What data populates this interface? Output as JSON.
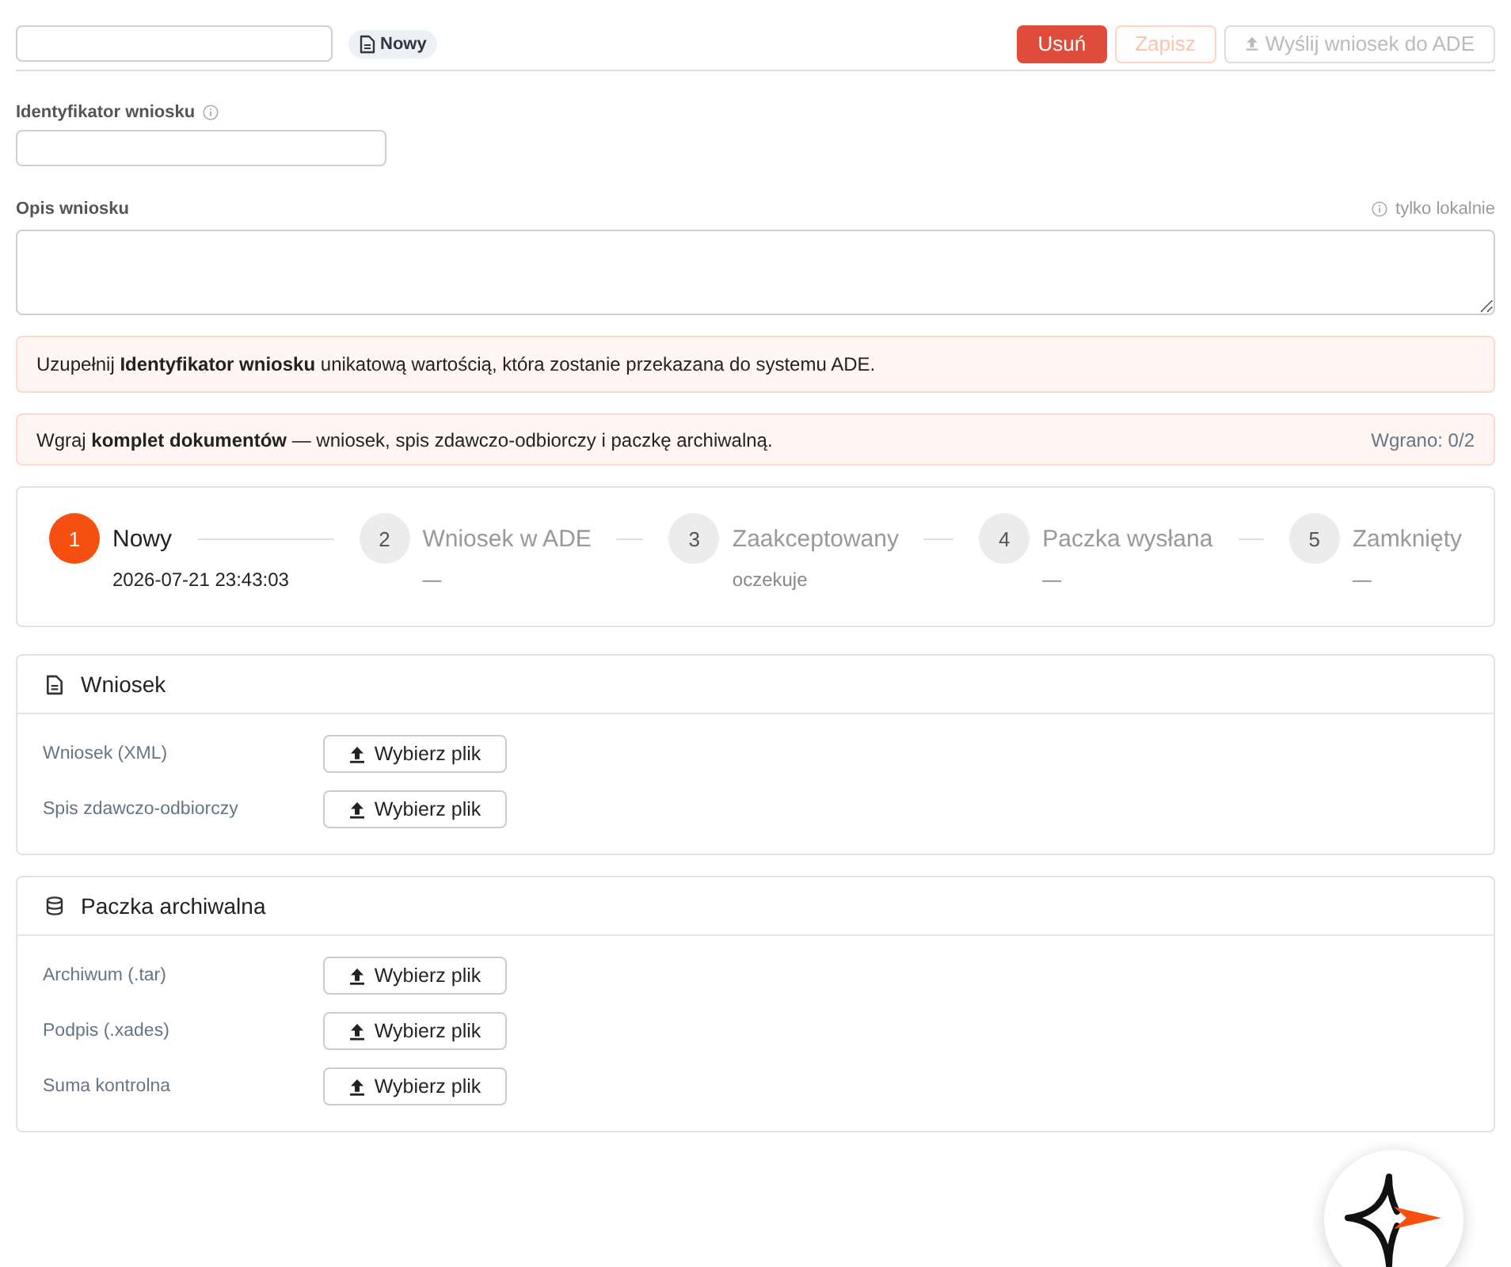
{
  "header": {
    "badge": {
      "label": "Nowy"
    },
    "buttons": [
      {
        "label": "Usuń",
        "kind": "danger",
        "disabled": false
      },
      {
        "label": "Zapisz",
        "kind": "primary",
        "disabled": true
      },
      {
        "label": "Wyślij wniosek do ADE",
        "kind": "send",
        "disabled": true
      }
    ]
  },
  "identifier": {
    "label": "Identyfikator wniosku"
  },
  "description": {
    "label": "Opis wniosku",
    "hint": "tylko lokalnie"
  },
  "alerts": [
    {
      "text": "Uzupełnij **Identyfikator wniosku** unikatową wartością, która zostanie przekazana do systemu ADE."
    },
    {
      "text": "Wgraj **komplet dokumentów** — wniosek, spis zdawczo-odbiorczy i paczkę archiwalną.",
      "counter": "Wgrano: 0/2"
    }
  ],
  "steps": [
    {
      "number": "1",
      "title": "Nowy",
      "detail": "2026-07-21 23:43:03",
      "current": true
    },
    {
      "number": "2",
      "title": "Wniosek w ADE",
      "detail": "—",
      "current": false
    },
    {
      "number": "3",
      "title": "Zaakceptowany",
      "detail": "oczekuje",
      "current": false
    },
    {
      "number": "4",
      "title": "Paczka wysłana",
      "detail": "—",
      "current": false
    },
    {
      "number": "5",
      "title": "Zamknięty",
      "detail": "—",
      "current": false
    }
  ],
  "sections": [
    {
      "title": "Wniosek",
      "kind": "document",
      "files": [
        {
          "label": "Wniosek (XML)",
          "button": "Wybierz plik"
        },
        {
          "label": "Spis zdawczo-odbiorczy",
          "button": "Wybierz plik"
        }
      ]
    },
    {
      "title": "Paczka archiwalna",
      "kind": "archive",
      "files": [
        {
          "label": "Archiwum (.tar)",
          "button": "Wybierz plik"
        },
        {
          "label": "Podpis (.xades)",
          "button": "Wybierz plik"
        },
        {
          "label": "Suma kontrolna",
          "button": "Wybierz plik"
        }
      ]
    }
  ]
}
